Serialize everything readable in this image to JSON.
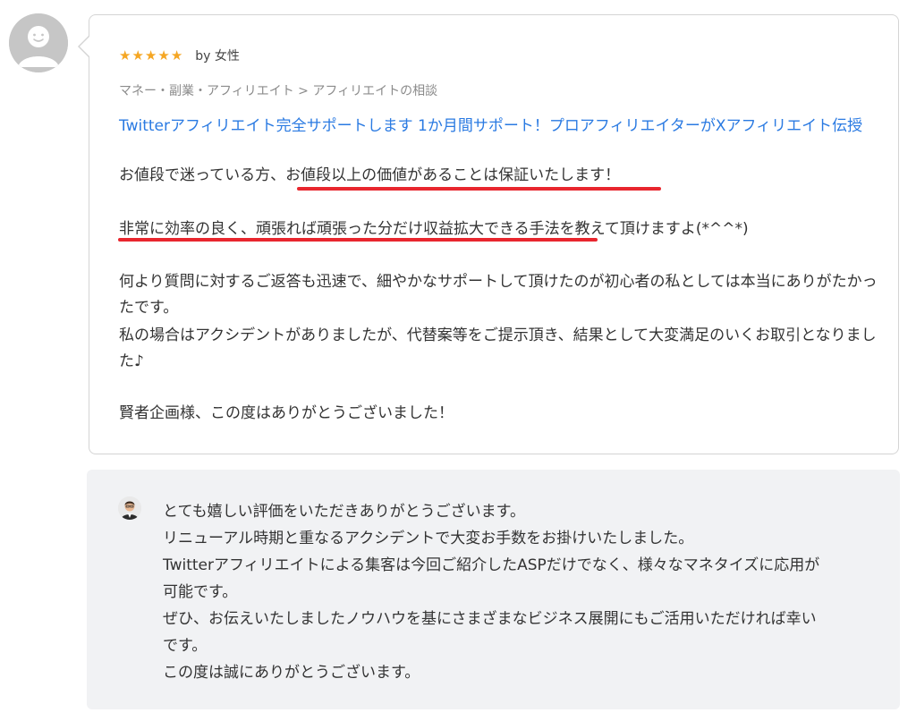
{
  "review": {
    "rating": 5,
    "byline": "by 女性",
    "breadcrumb": "マネー・副業・アフィリエイト > アフィリエイトの相談",
    "service_title": "Twitterアフィリエイト完全サポートします 1か月間サポート！プロアフィリエイターがXアフィリエイト伝授",
    "line1_pre": "お値段で迷っている方、",
    "line1_mark": "お値段以上の価値があることは保証いたします！",
    "line2_mark": "非常に効率の良く、頑張れば頑張った分だけ収益拡大できる手法",
    "line2_post": "を教えて頂けますよ(*^^*)",
    "line3": "何より質問に対するご返答も迅速で、細やかなサポートして頂けたのが初心者の私としては本当にありがたかったです。",
    "line4": "私の場合はアクシデントがありましたが、代替案等をご提示頂き、結果として大変満足のいくお取引となりました♪",
    "line5": "賢者企画様、この度はありがとうございました！"
  },
  "reply": {
    "lines": [
      "とても嬉しい評価をいただきありがとうございます。",
      "リニューアル時期と重なるアクシデントで大変お手数をお掛けいたしました。",
      "Twitterアフィリエイトによる集客は今回ご紹介したASPだけでなく、様々なマネタイズに応用が",
      "可能です。",
      "ぜひ、お伝えいたしましたノウハウを基にさまざまなビジネス展開にもご活用いただければ幸い",
      "です。",
      "この度は誠にありがとうございます。"
    ]
  },
  "colors": {
    "star": "#f5a623",
    "link": "#2a7ae2",
    "highlight_underline": "#e8262e",
    "reply_background": "#f1f2f4"
  },
  "icons": {
    "reviewer_avatar": "default-user-avatar-icon",
    "seller_avatar": "seller-photo-avatar-icon",
    "star": "star-icon"
  }
}
